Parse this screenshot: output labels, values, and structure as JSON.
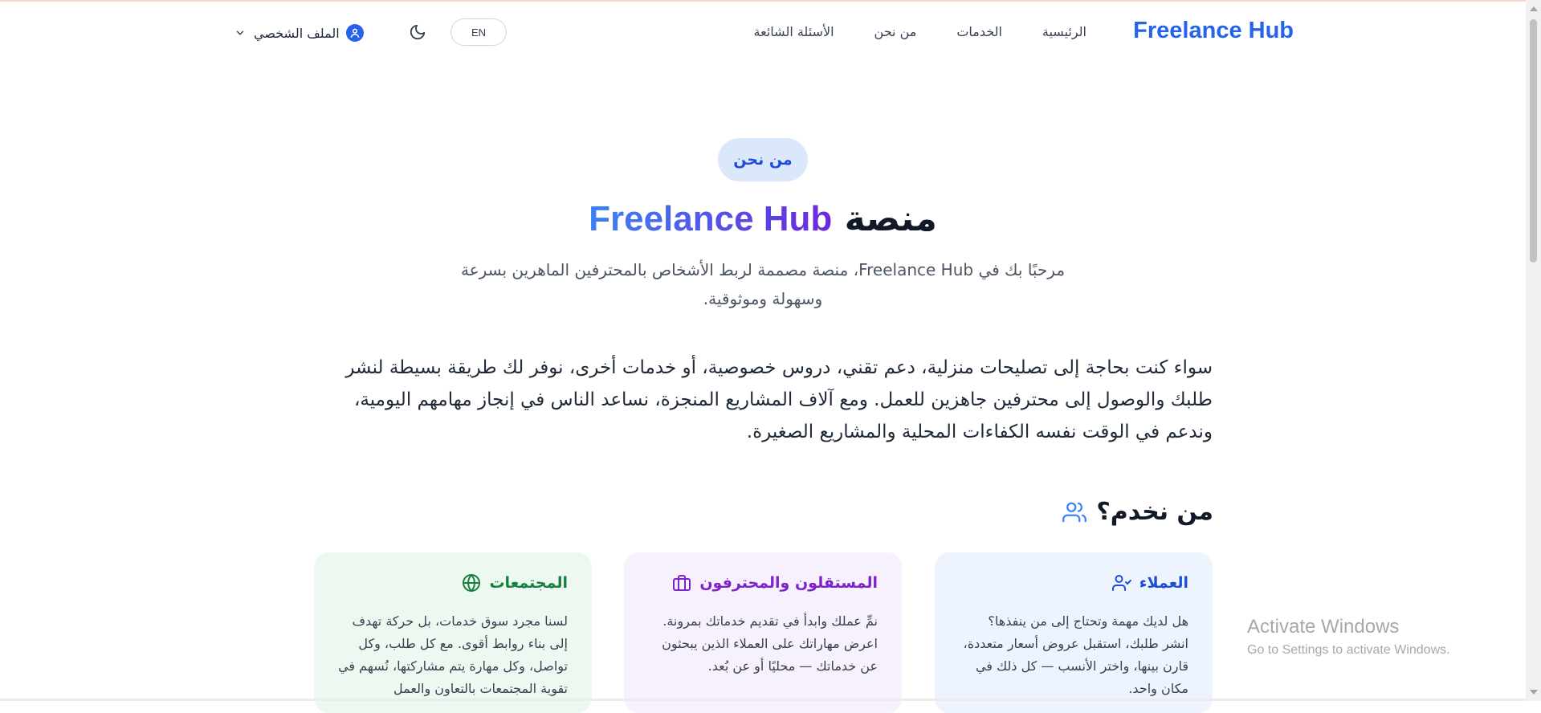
{
  "header": {
    "brand": "Freelance Hub",
    "nav": [
      "الرئيسية",
      "الخدمات",
      "من نحن",
      "الأسئلة الشائعة"
    ],
    "lang_button": "EN",
    "theme_icon": "moon-icon",
    "profile_label": "الملف الشخصي"
  },
  "hero": {
    "badge": "من نحن",
    "title_word": "منصة",
    "title_brand": "Freelance Hub",
    "subtitle": "مرحبًا بك في Freelance Hub، منصة مصممة لربط الأشخاص بالمحترفين الماهرين بسرعة وسهولة وموثوقية.",
    "paragraph": "سواء كنت بحاجة إلى تصليحات منزلية، دعم تقني، دروس خصوصية، أو خدمات أخرى، نوفر لك طريقة بسيطة لنشر طلبك والوصول إلى محترفين جاهزين للعمل. ومع آلاف المشاريع المنجزة، نساعد الناس في إنجاز مهامهم اليومية، وندعم في الوقت نفسه الكفاءات المحلية والمشاريع الصغيرة."
  },
  "who_we_serve": {
    "heading": "من نخدم؟",
    "cards": [
      {
        "title": "العملاء",
        "icon": "user-check-icon",
        "text": "هل لديك مهمة وتحتاج إلى من ينفذها؟ انشر طلبك، استقبل عروض أسعار متعددة، قارن بينها، واختر الأنسب — كل ذلك في مكان واحد."
      },
      {
        "title": "المستقلون والمحترفون",
        "icon": "briefcase-icon",
        "text": "نمِّ عملك وابدأ في تقديم خدماتك بمرونة. اعرض مهاراتك على العملاء الذين يبحثون عن خدماتك — محليًا أو عن بُعد."
      },
      {
        "title": "المجتمعات",
        "icon": "globe-icon",
        "text": "لسنا مجرد سوق خدمات، بل حركة تهدف إلى بناء روابط أقوى. مع كل طلب، وكل تواصل، وكل مهارة يتم مشاركتها، نُسهم في تقوية المجتمعات بالتعاون والعمل"
      }
    ]
  },
  "watermark": {
    "line1": "Activate Windows",
    "line2": "Go to Settings to activate Windows."
  },
  "colors": {
    "brand": "#2563eb",
    "clients_card": "#eef4fe",
    "freelancers_card": "#f7f0fd",
    "communities_card": "#edf8f1"
  }
}
